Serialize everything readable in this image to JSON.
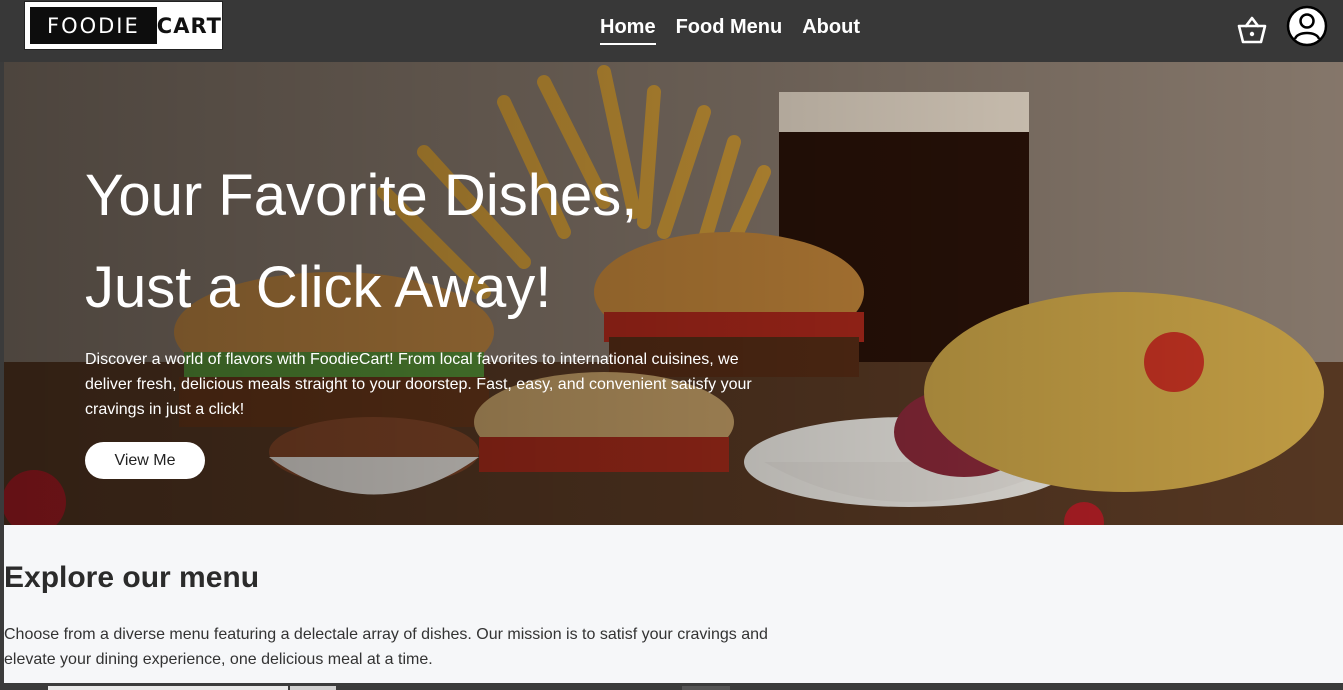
{
  "brand": {
    "left": "FOODIE",
    "right": "CART"
  },
  "nav": {
    "items": [
      {
        "label": "Home",
        "active": true
      },
      {
        "label": "Food Menu",
        "active": false
      },
      {
        "label": "About",
        "active": false
      }
    ],
    "icons": [
      "basket-icon",
      "user-icon"
    ]
  },
  "hero": {
    "title_line1": "Your Favorite Dishes,",
    "title_line2": "Just a Click Away!",
    "description": "Discover a world of flavors with FoodieCart! From local favorites to international cuisines, we deliver fresh, delicious meals straight to your doorstep. Fast, easy, and convenient satisfy your cravings in just a click!",
    "button_label": "View Me"
  },
  "explore": {
    "title": "Explore our menu",
    "description": "Choose from a diverse menu featuring a delectale array of dishes. Our mission is to satisf your cravings and elevate your dining experience, one delicious meal at a time."
  },
  "colors": {
    "navbar": "#383838",
    "explore_bg": "#f6f7f9",
    "text_dark": "#2b2b2b"
  }
}
